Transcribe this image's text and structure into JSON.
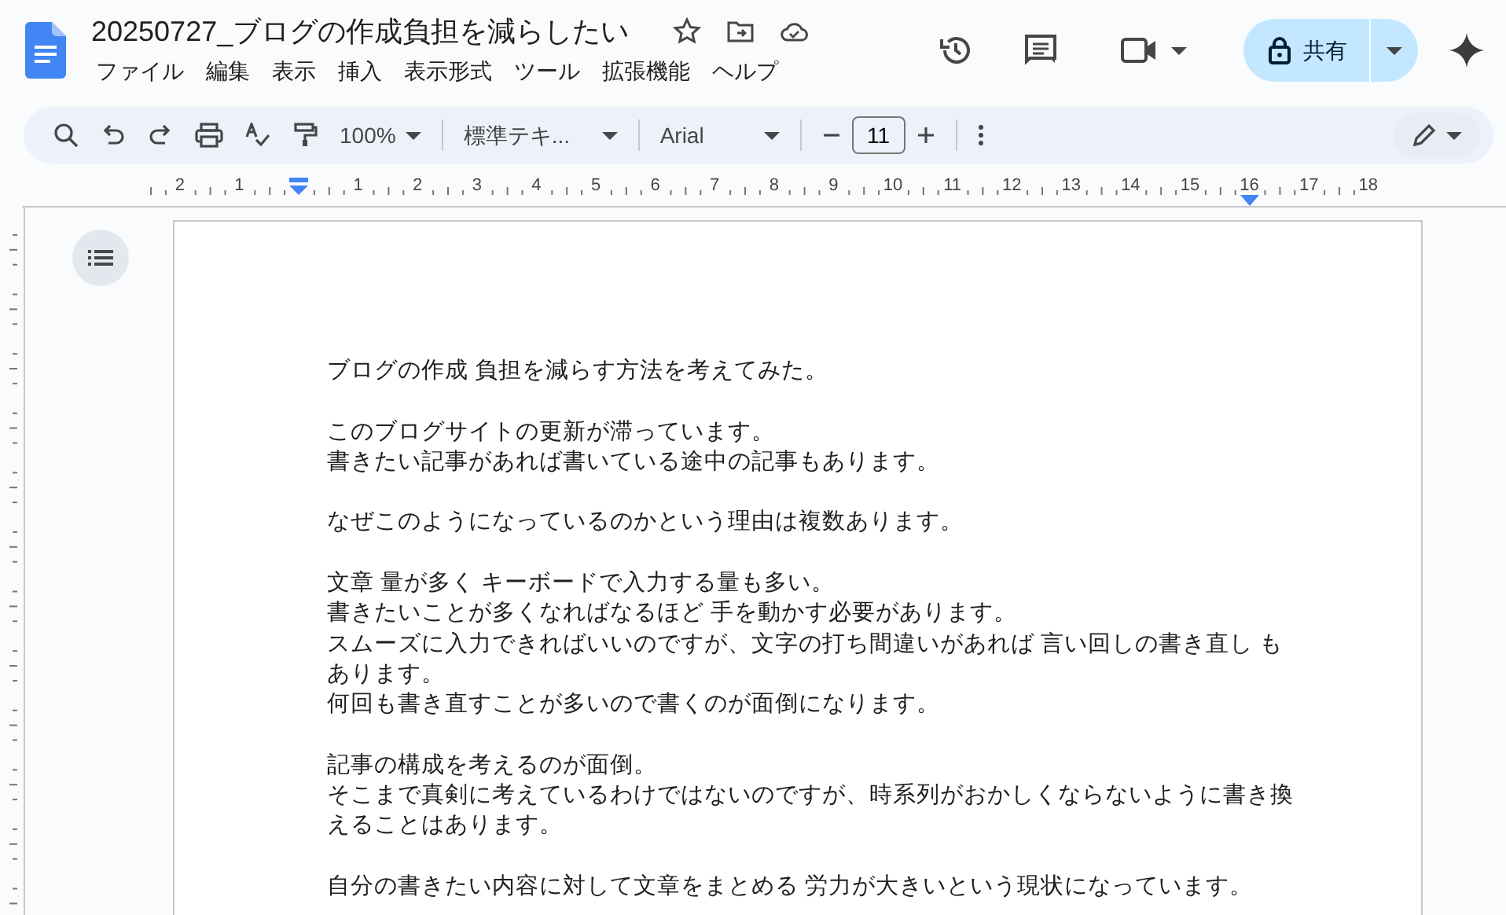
{
  "document": {
    "title": "20250727_ブログの作成負担を減らしたい"
  },
  "menu": [
    "ファイル",
    "編集",
    "表示",
    "挿入",
    "表示形式",
    "ツール",
    "拡張機能",
    "ヘルプ"
  ],
  "share_button": {
    "label": "共有"
  },
  "toolbar": {
    "zoom": "100%",
    "style": "標準テキ...",
    "font": "Arial",
    "font_size": "11"
  },
  "ruler": {
    "left_labels": [
      "2",
      "1"
    ],
    "right_labels": [
      "1",
      "2",
      "3",
      "4",
      "5",
      "6",
      "7",
      "8",
      "9",
      "10",
      "11",
      "12",
      "13",
      "14",
      "15",
      "16",
      "17",
      "18"
    ]
  },
  "body": [
    [
      [
        "ブログの作成 負担を減らす方法を考えてみた。"
      ]
    ],
    [
      [
        "このブログサイトの更新が滞っています。"
      ],
      [
        "書きたい記事があれば書いている途中の記事もあります。"
      ]
    ],
    [
      [
        "なぜこのようになっているのかという理由は複数あります。"
      ]
    ],
    [
      [
        "文章 量が多く キーボードで入力する量も多い。"
      ],
      [
        "書きたいことが多くなればなるほど 手を動かす必要があります。"
      ],
      [
        "スムーズに入力できればいいのですが、文字の打ち間違いがあれば 言い回しの書き直し も",
        "あります。"
      ],
      [
        "何回も書き直すことが多いので書くのが面倒になります。"
      ]
    ],
    [
      [
        "記事の構成を考えるのが面倒。"
      ],
      [
        "そこまで真剣に考えているわけではないのですが、時系列がおかしくならないように書き換",
        "えることはあります。"
      ]
    ],
    [
      [
        "自分の書きたい内容に対して文章をまとめる 労力が大きいという現状になっています。"
      ]
    ]
  ]
}
